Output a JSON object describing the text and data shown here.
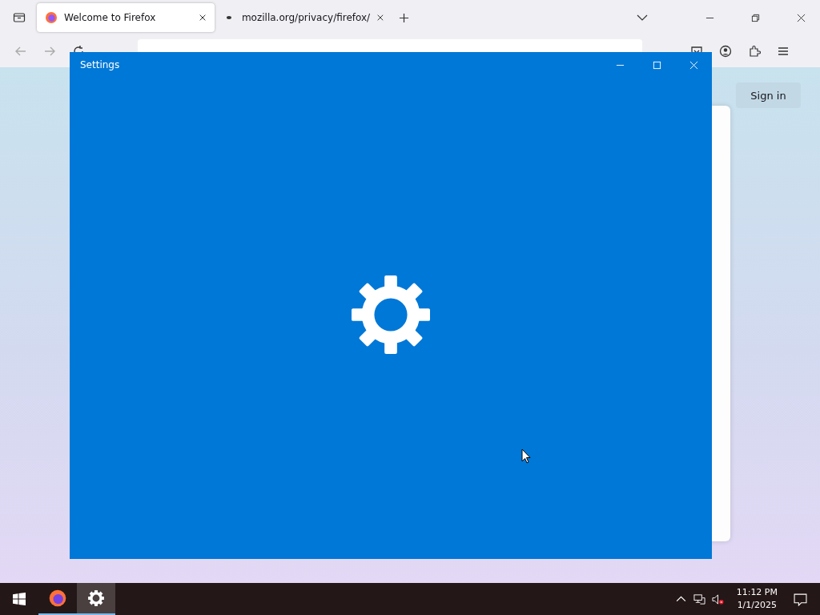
{
  "browser": {
    "tabs": [
      {
        "label": "Welcome to Firefox",
        "selected": true,
        "kind": "firefox"
      },
      {
        "label": "mozilla.org/privacy/firefox/",
        "selected": false,
        "kind": "dot"
      }
    ],
    "page": {
      "sign_in": "Sign in"
    }
  },
  "settings_window": {
    "title": "Settings"
  },
  "taskbar": {
    "apps": [
      {
        "kind": "firefox",
        "selected": false
      },
      {
        "kind": "settings",
        "selected": true
      }
    ],
    "time": "11:12 PM",
    "date": "1/1/2025"
  }
}
